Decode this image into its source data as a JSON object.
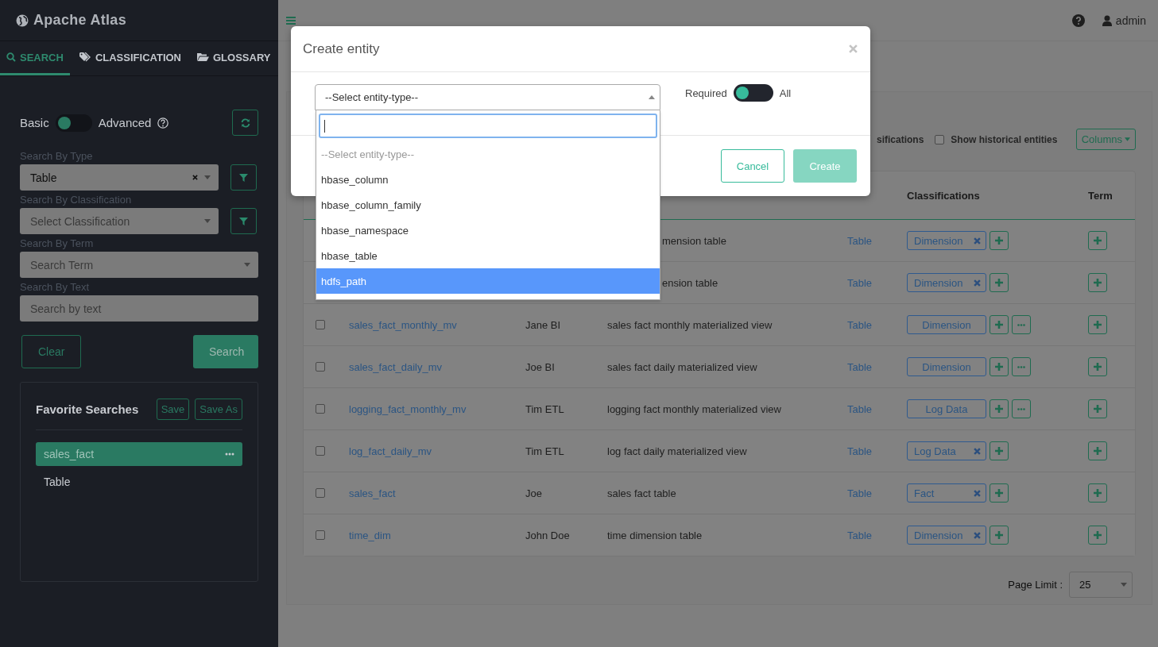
{
  "app": {
    "title": "Apache Atlas"
  },
  "sidebar_tabs": [
    {
      "label": "SEARCH",
      "selected": true
    },
    {
      "label": "CLASSIFICATION",
      "selected": false
    },
    {
      "label": "GLOSSARY",
      "selected": false
    }
  ],
  "search_mode": {
    "left": "Basic",
    "right": "Advanced",
    "advanced": false
  },
  "filters": [
    {
      "label": "Search By Type",
      "kind": "select",
      "value": "Table",
      "clearable": true,
      "filter_button": true
    },
    {
      "label": "Search By Classification",
      "kind": "select",
      "placeholder": "Select Classification",
      "clearable": false,
      "filter_button": true
    },
    {
      "label": "Search By Term",
      "kind": "select",
      "placeholder": "Search Term",
      "clearable": false,
      "filter_button": false
    },
    {
      "label": "Search By Text",
      "kind": "text",
      "placeholder": "Search by text",
      "filter_button": false
    }
  ],
  "actions": [
    {
      "label": "Clear",
      "kind": "outline"
    },
    {
      "label": "Search",
      "kind": "primary"
    }
  ],
  "favorites": {
    "title": "Favorite Searches",
    "buttons": [
      "Save",
      "Save As"
    ],
    "items": [
      {
        "label": "sales_fact",
        "selected": true
      },
      {
        "label": "Table",
        "selected": false
      }
    ]
  },
  "topbar": {
    "user": "admin"
  },
  "toolbar": {
    "partial_label": "sifications",
    "show_historical": {
      "label": "Show historical entities",
      "checked": false
    },
    "columns_button": "Columns"
  },
  "table": {
    "columns": [
      {
        "label": "Classifications"
      },
      {
        "label": "Term"
      }
    ],
    "rows": [
      {
        "description": "mension table",
        "type": "Table",
        "classification": {
          "label": "Dimension",
          "removable": true
        },
        "more": false
      },
      {
        "description": "ension table",
        "type": "Table",
        "classification": {
          "label": "Dimension",
          "removable": true
        },
        "more": false
      },
      {
        "checked": false,
        "name": "sales_fact_monthly_mv",
        "owner": "Jane BI",
        "description": "sales fact monthly materialized view",
        "type": "Table",
        "classification": {
          "label": "Dimension",
          "removable": false
        },
        "more": true
      },
      {
        "checked": false,
        "name": "sales_fact_daily_mv",
        "owner": "Joe BI",
        "description": "sales fact daily materialized view",
        "type": "Table",
        "classification": {
          "label": "Dimension",
          "removable": false
        },
        "more": true
      },
      {
        "checked": false,
        "name": "logging_fact_monthly_mv",
        "owner": "Tim ETL",
        "description": "logging fact monthly materialized view",
        "type": "Table",
        "classification": {
          "label": "Log Data",
          "removable": false
        },
        "more": true
      },
      {
        "checked": false,
        "name": "log_fact_daily_mv",
        "owner": "Tim ETL",
        "description": "log fact daily materialized view",
        "type": "Table",
        "classification": {
          "label": "Log Data",
          "removable": true
        },
        "more": false
      },
      {
        "checked": false,
        "name": "sales_fact",
        "owner": "Joe",
        "description": "sales fact table",
        "type": "Table",
        "classification": {
          "label": "Fact",
          "removable": true
        },
        "more": false
      },
      {
        "checked": false,
        "name": "time_dim",
        "owner": "John Doe",
        "description": "time dimension table",
        "type": "Table",
        "classification": {
          "label": "Dimension",
          "removable": true
        },
        "more": false
      }
    ]
  },
  "page_limit": {
    "label": "Page Limit :",
    "value": "25"
  },
  "modal": {
    "title": "Create entity",
    "select": {
      "value": "--Select entity-type--"
    },
    "toggle": {
      "left": "Required",
      "right": "All",
      "all": false
    },
    "options": [
      {
        "label": "--Select entity-type--",
        "kind": "placeholder",
        "selected": false
      },
      {
        "label": "hbase_column",
        "kind": "option",
        "selected": false
      },
      {
        "label": "hbase_column_family",
        "kind": "option",
        "selected": false
      },
      {
        "label": "hbase_namespace",
        "kind": "option",
        "selected": false
      },
      {
        "label": "hbase_table",
        "kind": "option",
        "selected": false
      },
      {
        "label": "hdfs_path",
        "kind": "option",
        "selected": true
      }
    ],
    "buttons": [
      {
        "label": "Cancel",
        "kind": "secondary",
        "disabled": false
      },
      {
        "label": "Create",
        "kind": "primary",
        "disabled": true
      }
    ]
  }
}
